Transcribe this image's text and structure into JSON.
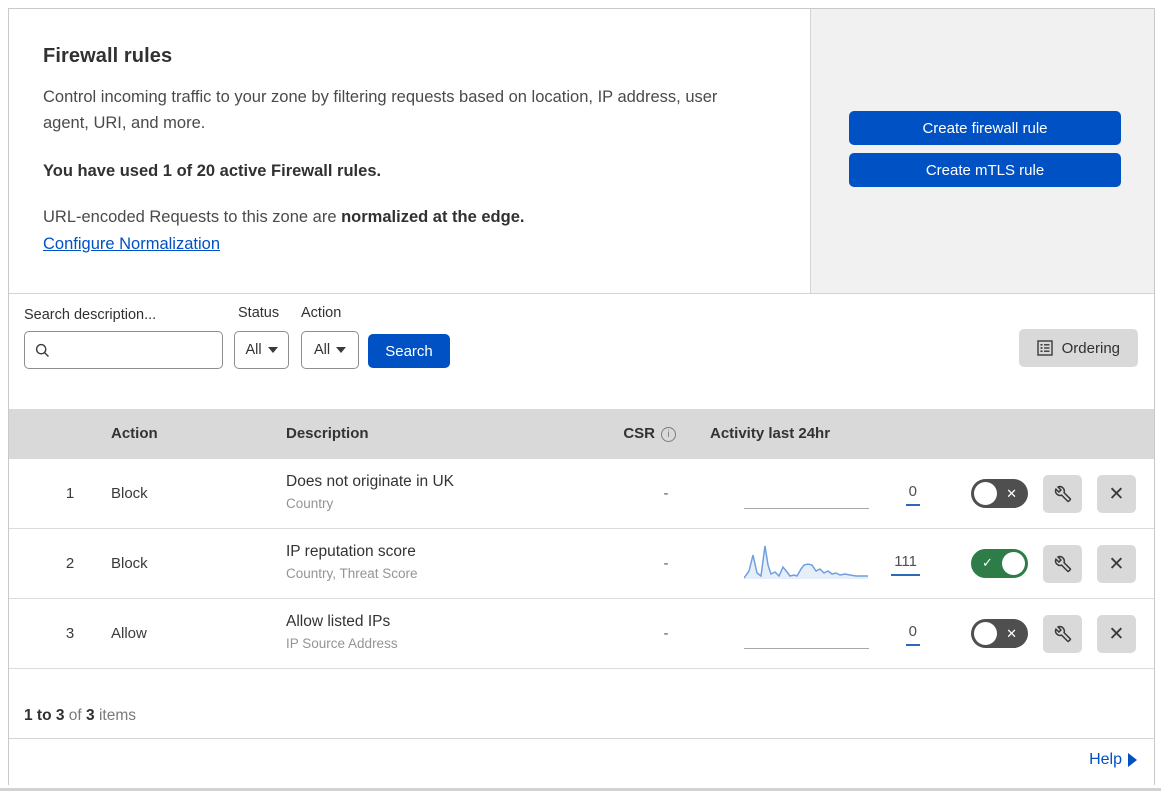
{
  "header": {
    "title": "Firewall rules",
    "description": "Control incoming traffic to your zone by filtering requests based on location, IP address, user agent, URI, and more.",
    "usage_line": "You have used 1 of 20 active Firewall rules.",
    "normalization_text": "URL-encoded Requests to this zone are ",
    "normalization_bold": "normalized at the edge.",
    "normalization_link": "Configure Normalization",
    "create_firewall_button": "Create firewall rule",
    "create_mtls_button": "Create mTLS rule"
  },
  "filters": {
    "search_label": "Search description...",
    "search_value": "",
    "status_label": "Status",
    "status_value": "All",
    "action_label": "Action",
    "action_value": "All",
    "search_button": "Search",
    "ordering_button": "Ordering"
  },
  "table": {
    "columns": {
      "action": "Action",
      "description": "Description",
      "csr": "CSR",
      "csr_info_icon": "i",
      "activity": "Activity last 24hr"
    },
    "rows": [
      {
        "priority": "1",
        "action": "Block",
        "description": "Does not originate in UK",
        "fields": "Country",
        "csr": "-",
        "activity_count": "0",
        "enabled": false,
        "sparkline": null
      },
      {
        "priority": "2",
        "action": "Block",
        "description": "IP reputation score",
        "fields": "Country, Threat Score",
        "csr": "-",
        "activity_count": "111",
        "enabled": true,
        "sparkline": [
          [
            0,
            35
          ],
          [
            5,
            28
          ],
          [
            9,
            12
          ],
          [
            13,
            30
          ],
          [
            17,
            33
          ],
          [
            21,
            3
          ],
          [
            24,
            22
          ],
          [
            27,
            31
          ],
          [
            31,
            29
          ],
          [
            35,
            33
          ],
          [
            39,
            24
          ],
          [
            43,
            29
          ],
          [
            46,
            33
          ],
          [
            50,
            32
          ],
          [
            53,
            33
          ],
          [
            57,
            26
          ],
          [
            60,
            22
          ],
          [
            64,
            21
          ],
          [
            68,
            22
          ],
          [
            72,
            28
          ],
          [
            76,
            26
          ],
          [
            80,
            30
          ],
          [
            84,
            28
          ],
          [
            88,
            31
          ],
          [
            92,
            30
          ],
          [
            96,
            32
          ],
          [
            101,
            31
          ],
          [
            106,
            32
          ],
          [
            112,
            33
          ],
          [
            118,
            33
          ],
          [
            124,
            33
          ]
        ]
      },
      {
        "priority": "3",
        "action": "Allow",
        "description": "Allow listed IPs",
        "fields": "IP Source Address",
        "csr": "-",
        "activity_count": "0",
        "enabled": false,
        "sparkline": null
      }
    ],
    "footer": {
      "range": "1 to 3",
      "of": "of",
      "total": "3",
      "items": "items"
    }
  },
  "help": {
    "label": "Help"
  },
  "colors": {
    "primary_blue": "#0051c3",
    "toggle_green": "#2e7d49",
    "toggle_off_gray": "#4f4f4f",
    "spark_blue": "#6f9fe0",
    "table_header_gray": "#d9d9d9"
  }
}
